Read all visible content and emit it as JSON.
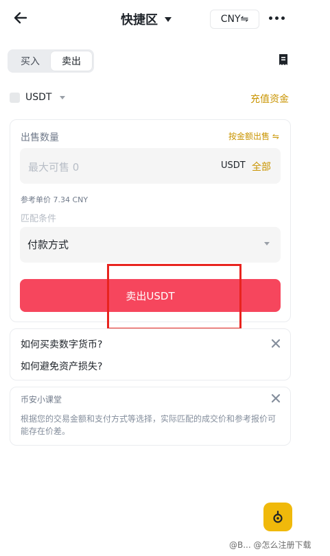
{
  "header": {
    "title": "快捷区",
    "currency": "CNY⇋"
  },
  "tabs": {
    "buy": "买入",
    "sell": "卖出"
  },
  "asset": {
    "coin": "USDT",
    "fund_link": "充值资金"
  },
  "form": {
    "sell_amount_label": "出售数量",
    "by_amount_label": "按金额出售 ⇋",
    "amount_placeholder": "最大可售 0",
    "amount_unit": "USDT",
    "all_label": "全部",
    "reference_price": "参考单价 7.34 CNY",
    "match_label": "匹配条件",
    "payment_method": "付款方式",
    "sell_button": "卖出USDT"
  },
  "faq": {
    "q1": "如何买卖数字货币?",
    "q2": "如何避免资产损失?"
  },
  "tip": {
    "title": "币安小课堂",
    "body": "根据您的交易金额和支付方式等选择，实际匹配的成交价和参考报价可能存在价差。"
  },
  "watermark": "@B... @怎么注册下载",
  "colors": {
    "accent": "#F0B90B",
    "sell_button": "#F6465D",
    "highlight_box": "#E8231E"
  }
}
